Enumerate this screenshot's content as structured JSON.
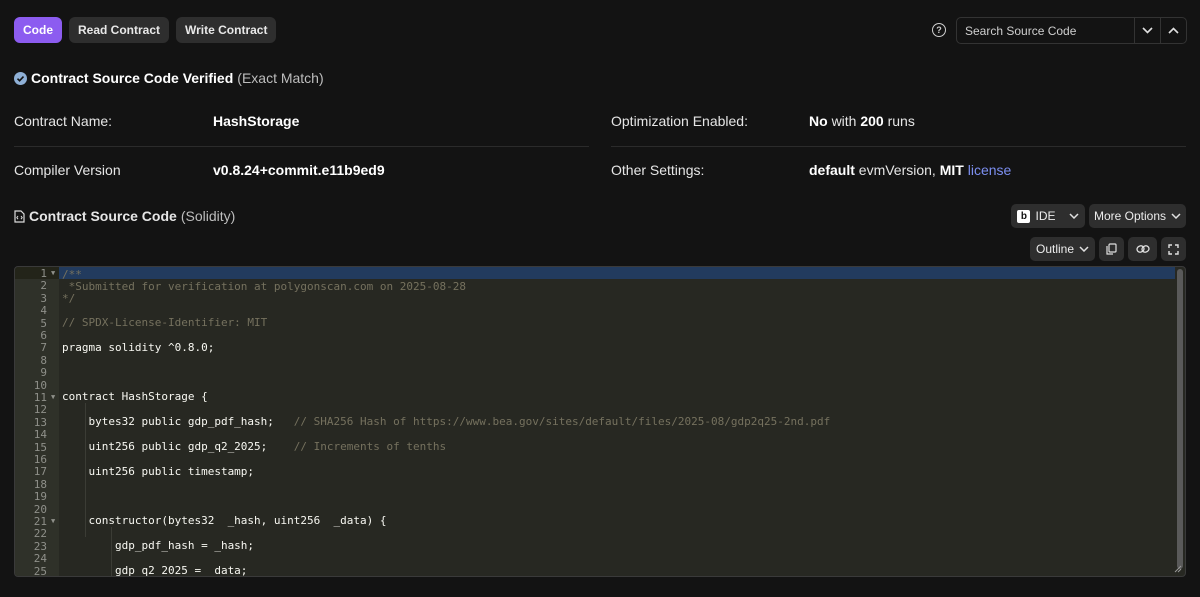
{
  "tabs": [
    {
      "label": "Code"
    },
    {
      "label": "Read Contract"
    },
    {
      "label": "Write Contract"
    }
  ],
  "search": {
    "placeholder": "Search Source Code"
  },
  "verified": {
    "title": "Contract Source Code Verified",
    "match": "(Exact Match)"
  },
  "info": {
    "contract_name_label": "Contract Name:",
    "contract_name": "HashStorage",
    "compiler_label": "Compiler Version",
    "compiler": "v0.8.24+commit.e11b9ed9",
    "optimization_label": "Optimization Enabled:",
    "optimization_no": "No",
    "optimization_with": "with",
    "optimization_runs": "200",
    "optimization_runs_suffix": "runs",
    "other_label": "Other Settings:",
    "other_default": "default",
    "other_evm": "evmVersion,",
    "other_license_type": "MIT",
    "other_license_link": "license"
  },
  "source": {
    "title": "Contract Source Code",
    "lang": "(Solidity)",
    "ide_label": "IDE",
    "ide_badge": "b",
    "more_options": "More Options",
    "outline": "Outline"
  },
  "code_lines": [
    "/**",
    " *Submitted for verification at polygonscan.com on 2025-08-28",
    "*/",
    "",
    "// SPDX-License-Identifier: MIT",
    "",
    "pragma solidity ^0.8.0;",
    "",
    "",
    "",
    "contract HashStorage {",
    "",
    "    bytes32 public gdp_pdf_hash;   // SHA256 Hash of https://www.bea.gov/sites/default/files/2025-08/gdp2q25-2nd.pdf",
    "",
    "    uint256 public gdp_q2_2025;    // Increments of tenths",
    "",
    "    uint256 public timestamp;",
    "",
    "",
    "",
    "    constructor(bytes32  _hash, uint256  _data) {",
    "",
    "        gdp_pdf_hash = _hash;",
    "",
    "        gdp_q2_2025 = _data;"
  ],
  "fold_lines": [
    1,
    11,
    21
  ],
  "colors": {
    "accent": "#8c5cf0",
    "link": "#7c8ff0",
    "editor_bg": "#272822",
    "comment": "#75715e"
  }
}
